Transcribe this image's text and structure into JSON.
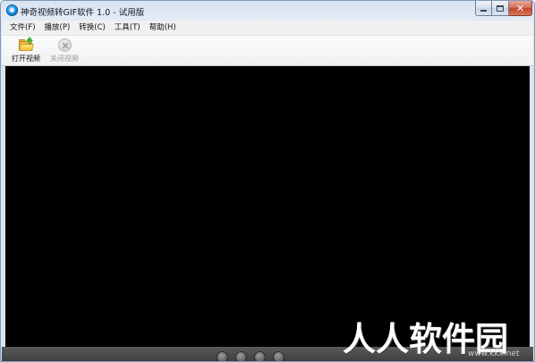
{
  "window": {
    "title": "神奇视频转GIF软件 1.0 - 试用版",
    "controls": {
      "minimize_icon": "minimize-icon",
      "maximize_icon": "maximize-icon",
      "close_icon": "close-icon"
    }
  },
  "menu": {
    "items": [
      {
        "label": "文件(F)"
      },
      {
        "label": "播放(P)"
      },
      {
        "label": "转换(C)"
      },
      {
        "label": "工具(T)"
      },
      {
        "label": "帮助(H)"
      }
    ]
  },
  "toolbar": {
    "open_video": {
      "label": "打开视频",
      "icon": "open-folder-icon",
      "enabled": true
    },
    "close_video": {
      "label": "关闭视频",
      "icon": "close-video-icon",
      "enabled": false
    }
  },
  "player": {
    "background_color": "#000000",
    "controls": [
      "previous-icon",
      "stop-icon",
      "play-icon",
      "next-icon"
    ]
  },
  "watermark": {
    "main": "人人软件园",
    "sub": "www.kkx.net"
  }
}
